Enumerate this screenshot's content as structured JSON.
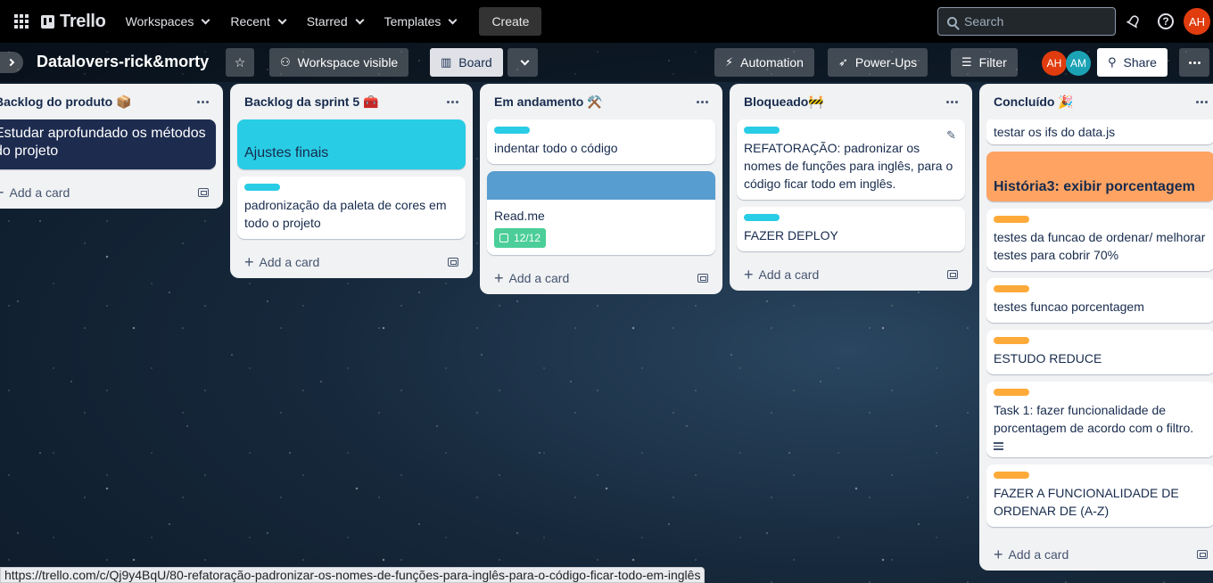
{
  "topbar": {
    "logo": "Trello",
    "nav": [
      "Workspaces",
      "Recent",
      "Starred",
      "Templates"
    ],
    "create": "Create",
    "search_placeholder": "Search",
    "user_initials": "AH"
  },
  "board": {
    "title": "Datalovers-rick&morty",
    "visibility": "Workspace visible",
    "view": "Board",
    "automation": "Automation",
    "powerups": "Power-Ups",
    "filter": "Filter",
    "members": [
      {
        "initials": "AH",
        "color": "#e03c0e"
      },
      {
        "initials": "AM",
        "color": "#1ba3b5"
      }
    ],
    "share": "Share",
    "add_card": "Add a card"
  },
  "lists": [
    {
      "title": "Backlog do produto 📦",
      "cards": [
        {
          "type": "dark-cover",
          "text": "Estudar aprofundado os métodos do projeto"
        }
      ]
    },
    {
      "title": "Backlog da sprint 5 🧰",
      "cards": [
        {
          "type": "cyan-cover",
          "text": "Ajustes finais"
        },
        {
          "type": "labeled",
          "label_color": "#29cce5",
          "text": "padronização da paleta de cores em todo o projeto"
        }
      ]
    },
    {
      "title": "Em andamento ⚒️",
      "cards": [
        {
          "type": "labeled",
          "label_color": "#29cce5",
          "text": "indentar todo o código"
        },
        {
          "type": "strip-cover",
          "text": "Read.me",
          "checklist": "12/12"
        }
      ]
    },
    {
      "title": "Bloqueado🚧",
      "cards": [
        {
          "type": "labeled",
          "label_color": "#29cce5",
          "text": "REFATORAÇÃO: padronizar os nomes de funções para inglês, para o código ficar todo em inglês."
        },
        {
          "type": "labeled",
          "label_color": "#29cce5",
          "text": "FAZER DEPLOY"
        }
      ]
    },
    {
      "title": "Concluído 🎉",
      "cards": [
        {
          "type": "plain",
          "text": "testar os ifs do data.js"
        },
        {
          "type": "orange-cover",
          "text": "História3: exibir porcentagem"
        },
        {
          "type": "labeled",
          "label_color": "#feaa3a",
          "text": "testes da funcao de ordenar/ melhorar testes para cobrir 70%"
        },
        {
          "type": "labeled",
          "label_color": "#feaa3a",
          "text": "testes funcao porcentagem"
        },
        {
          "type": "labeled",
          "label_color": "#feaa3a",
          "text": "ESTUDO REDUCE"
        },
        {
          "type": "labeled",
          "label_color": "#feaa3a",
          "text": "Task 1: fazer funcionalidade de porcentagem de acordo com o filtro."
        },
        {
          "type": "labeled",
          "label_color": "#feaa3a",
          "text": "FAZER A FUNCIONALIDADE DE ORDENAR DE (A-Z)"
        }
      ]
    }
  ],
  "status_url": "https://trello.com/c/Qj9y4BqU/80-refatoração-padronizar-os-nomes-de-funções-para-inglês-para-o-código-ficar-todo-em-inglês"
}
